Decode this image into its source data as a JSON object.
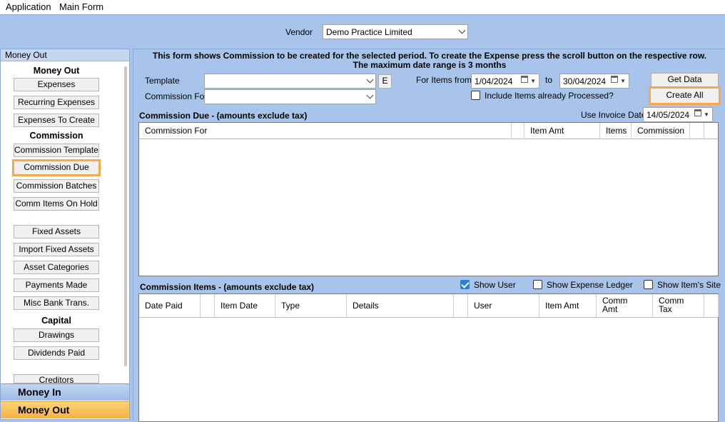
{
  "menubar": {
    "items": [
      "Application",
      "Main Form"
    ]
  },
  "vendor": {
    "label": "Vendor",
    "value": "Demo Practice Limited"
  },
  "sidebar": {
    "header": "Money Out",
    "sections": {
      "money_out": "Money Out",
      "commission": "Commission",
      "capital": "Capital"
    },
    "buttons": {
      "expenses": "Expenses",
      "recurring": "Recurring Expenses",
      "to_create": "Expenses To Create",
      "comm_templates": "Commission Templates",
      "comm_due": "Commission Due",
      "comm_batches": "Commission Batches",
      "comm_hold": "Comm Items On Hold",
      "fixed_assets": "Fixed Assets",
      "import_fixed": "Import Fixed Assets",
      "asset_cats": "Asset Categories",
      "payments": "Payments Made",
      "misc_bank": "Misc Bank Trans.",
      "drawings": "Drawings",
      "dividends": "Dividends Paid",
      "creditors": "Creditors"
    },
    "nav": {
      "money_in": "Money In",
      "money_out": "Money Out"
    }
  },
  "main": {
    "info_line1": "This form shows Commission to be created for the selected period. To create the Expense press the scroll button on the respective row.",
    "info_line2": "The maximum date range is 3 months",
    "template_label": "Template",
    "template_value": "",
    "e_button": "E",
    "commission_for_label": "Commission For",
    "commission_for_value": "",
    "items_from_label": "For Items from",
    "from_date": "1/04/2024",
    "to_label": "to",
    "to_date": "30/04/2024",
    "include_processed": "Include Items already Processed?",
    "get_data": "Get Data",
    "create_all": "Create All",
    "commission_due_title": "Commission Due - (amounts exclude tax)",
    "use_invoice_date_label": "Use Invoice Date",
    "invoice_date": "14/05/2024",
    "due_columns": [
      "Commission For",
      "Item Amt",
      "Items",
      "Commission"
    ],
    "items_title": "Commission Items - (amounts exclude tax)",
    "show_user": "Show User",
    "show_expense_ledger": "Show Expense Ledger",
    "show_item_site": "Show Item's Site",
    "item_columns": [
      "Date Paid",
      "Item Date",
      "Type",
      "Details",
      "User",
      "Item Amt",
      "Comm\nAmt",
      "Comm\nTax"
    ]
  },
  "colors": {
    "background": "#a9c4ea",
    "highlight": "#f6a94c",
    "money_out_nav": "#f6b23c"
  }
}
